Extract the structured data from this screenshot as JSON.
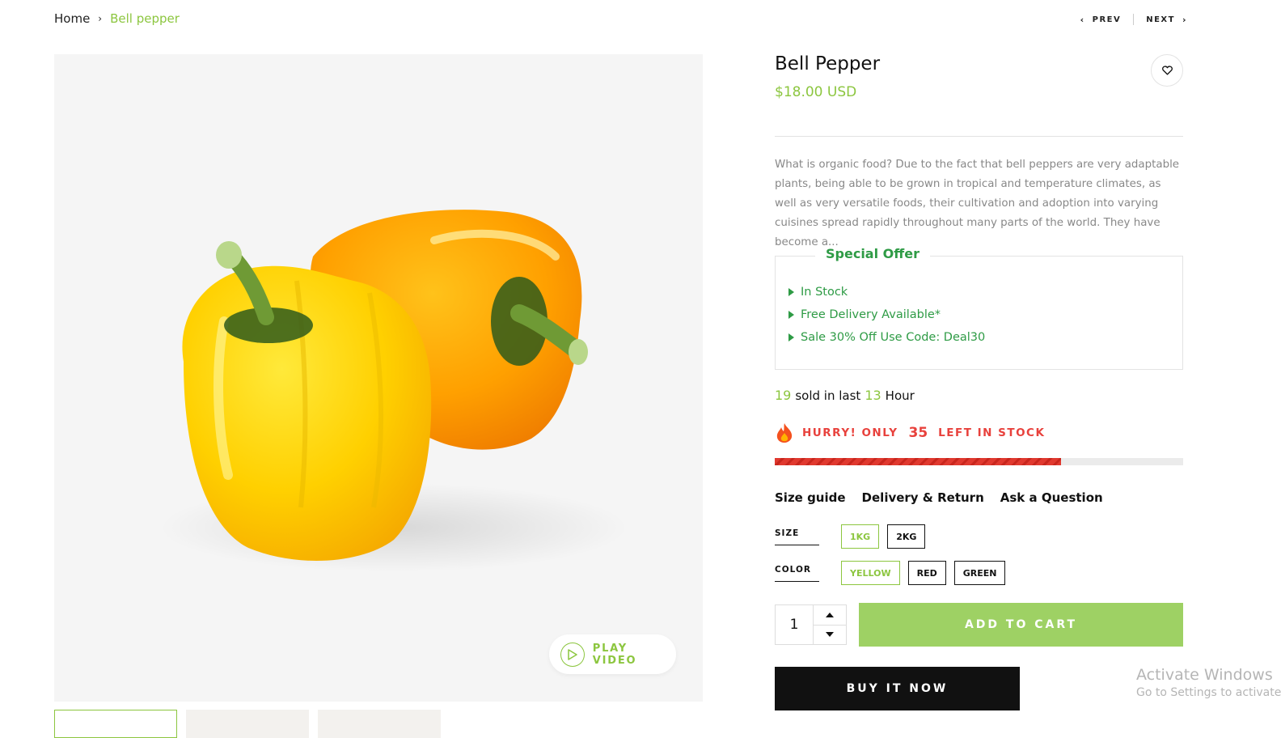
{
  "breadcrumb": {
    "home": "Home",
    "separator": "›",
    "current": "Bell pepper"
  },
  "pager": {
    "prev": "PREV",
    "next": "NEXT"
  },
  "gallery": {
    "play_label": "PLAY VIDEO",
    "thumb_count": 3
  },
  "product": {
    "title": "Bell Pepper",
    "price": "$18.00 USD",
    "description": "What is organic food? Due to the fact that bell peppers are very adaptable plants, being able to be grown in tropical and temperature climates, as well as very versatile foods, their cultivation and adoption into varying cuisines spread rapidly throughout many parts of the world. They have become a..."
  },
  "special_offer": {
    "title": "Special Offer",
    "items": [
      "In Stock",
      "Free Delivery Available*",
      "Sale 30% Off Use Code: Deal30"
    ]
  },
  "sold": {
    "count": "19",
    "text1": "sold in last",
    "hours": "13",
    "text2": "Hour"
  },
  "stock": {
    "prefix": "HURRY! ONLY",
    "count": "35",
    "suffix": "LEFT IN STOCK",
    "fill_fraction": 0.7
  },
  "info_links": [
    "Size guide",
    "Delivery & Return",
    "Ask a Question"
  ],
  "size": {
    "label": "SIZE",
    "options": [
      "1KG",
      "2KG"
    ],
    "selected": "1KG"
  },
  "color": {
    "label": "COLOR",
    "options": [
      "YELLOW",
      "RED",
      "GREEN"
    ],
    "selected": "YELLOW"
  },
  "quantity": "1",
  "buttons": {
    "add_to_cart": "ADD TO CART",
    "buy_now": "BUY IT NOW"
  },
  "watermark": {
    "line1": "Activate Windows",
    "line2": "Go to Settings to activate Windows."
  },
  "colors": {
    "accent": "#8cc63f",
    "offer": "#2e9b45",
    "alert": "#e8413c",
    "cart": "#9ed164"
  }
}
